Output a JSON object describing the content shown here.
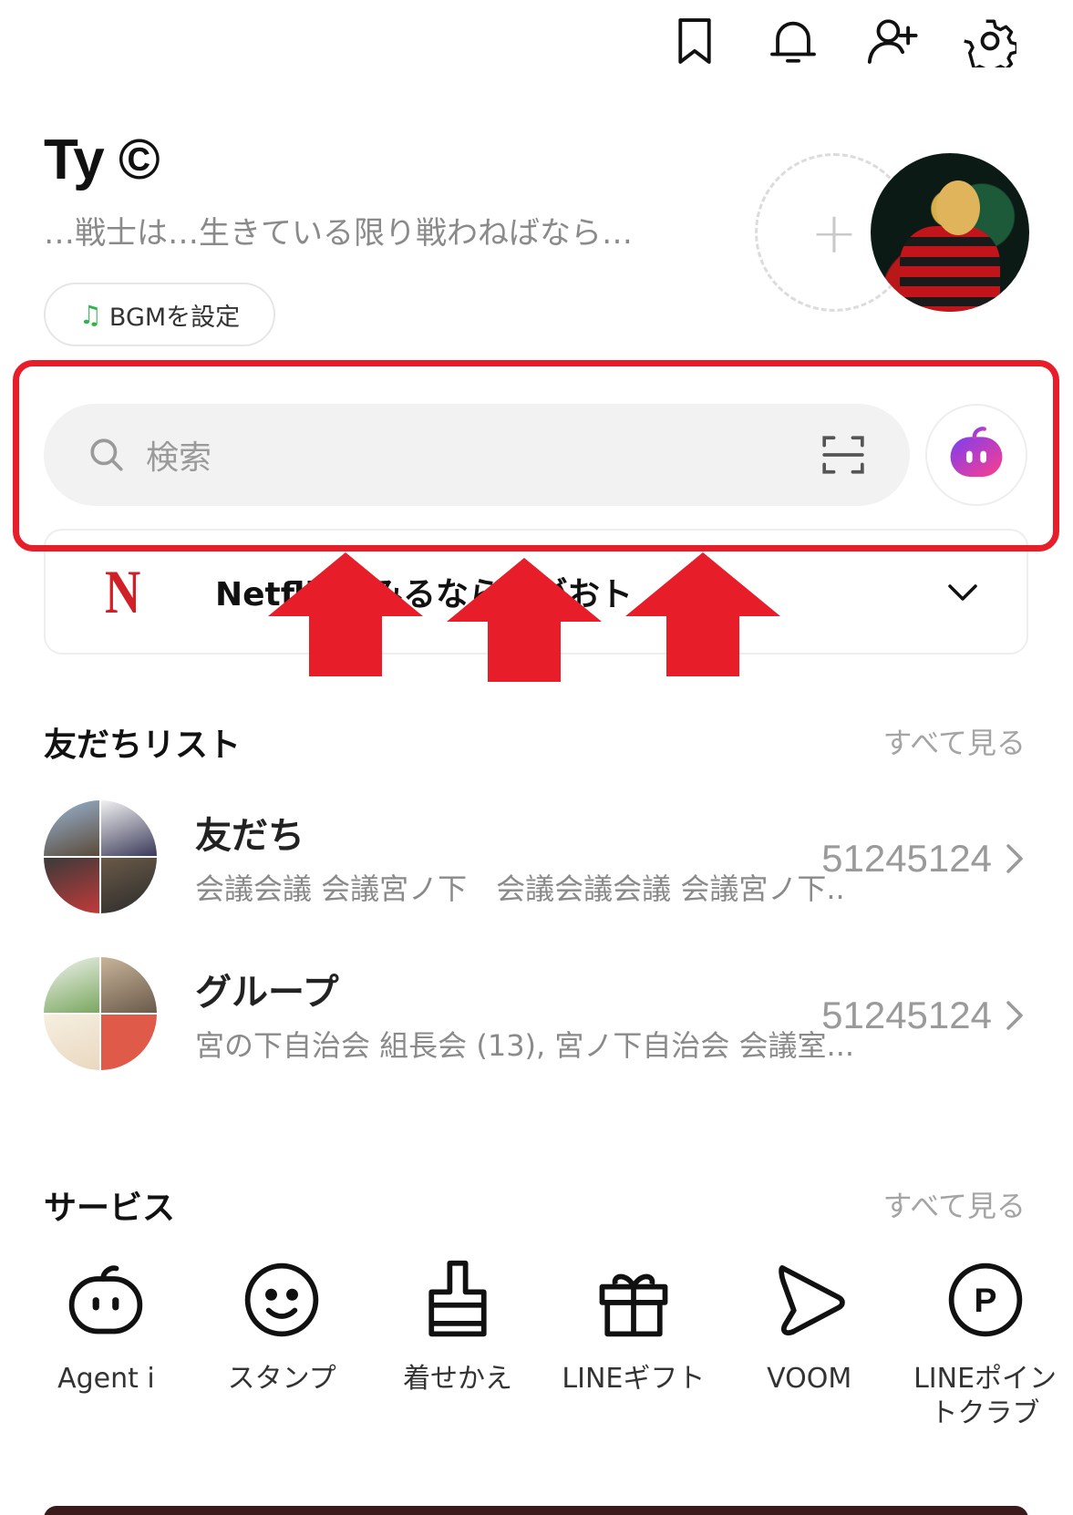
{
  "top_icons": [
    "bookmark-icon",
    "bell-icon",
    "add-friend-icon",
    "settings-icon"
  ],
  "profile": {
    "name": "Ty ©",
    "status": "…戦士は…生きている限り戦わねばなら…",
    "bgm_label": "BGMを設定",
    "add_symbol": "+"
  },
  "search": {
    "placeholder": "検索"
  },
  "banner": {
    "text": "Netflixはみるならーがおト",
    "logo": "N"
  },
  "friends_section": {
    "title": "友だちリスト",
    "see_all": "すべて見る",
    "rows": [
      {
        "title": "友だち",
        "subtitle": "会議会議 会議宮ノ下　会議会議会議 会議宮ノ下..",
        "count": "51245124"
      },
      {
        "title": "グループ",
        "subtitle": "宮の下自治会 組長会 (13), 宮ノ下自治会 会議室...",
        "count": "51245124"
      }
    ]
  },
  "services_section": {
    "title": "サービス",
    "see_all": "すべて見る",
    "items": [
      {
        "label": "Agent i",
        "icon": "agent-icon"
      },
      {
        "label": "スタンプ",
        "icon": "sticker-icon"
      },
      {
        "label": "着せかえ",
        "icon": "theme-icon"
      },
      {
        "label": "LINEギフト",
        "icon": "gift-icon"
      },
      {
        "label": "VOOM",
        "icon": "voom-icon"
      },
      {
        "label": "LINEポイントクラブ",
        "icon": "points-icon"
      }
    ]
  },
  "colors": {
    "highlight": "#e71d2a",
    "netflix": "#d01f26",
    "agent_gradient": [
      "#7b3ff2",
      "#ff3d8b"
    ]
  }
}
